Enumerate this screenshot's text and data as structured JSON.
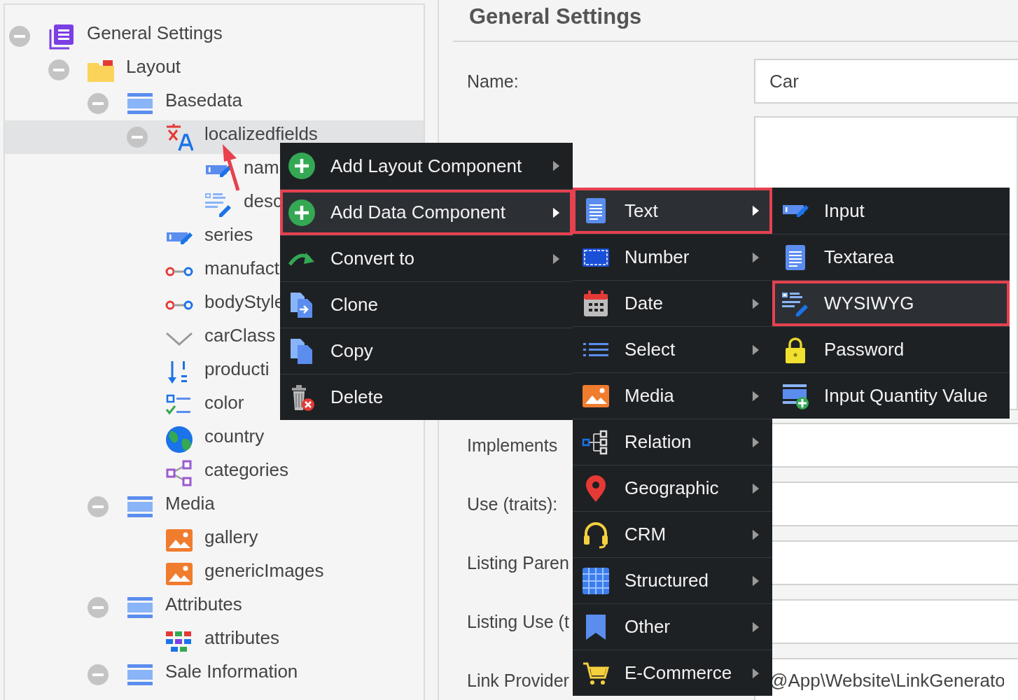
{
  "tree": [
    {
      "label": "General Settings",
      "kind": "root",
      "expanded": true,
      "selected": false,
      "children": [
        {
          "label": "Layout",
          "kind": "layout",
          "expanded": true,
          "selected": false,
          "children": [
            {
              "label": "Basedata",
              "kind": "panel",
              "expanded": true,
              "selected": false,
              "children": [
                {
                  "label": "localizedfields",
                  "kind": "localizedfields",
                  "expanded": true,
                  "selected": true,
                  "children": [
                    {
                      "label": "nam",
                      "kind": "input",
                      "selected": false
                    },
                    {
                      "label": "desc",
                      "kind": "wysiwyg",
                      "selected": false
                    }
                  ]
                },
                {
                  "label": "series",
                  "kind": "input",
                  "selected": false
                },
                {
                  "label": "manufact",
                  "kind": "manyToOneRelation",
                  "selected": false
                },
                {
                  "label": "bodyStyle",
                  "kind": "manyToOneRelation",
                  "selected": false
                },
                {
                  "label": "carClass",
                  "kind": "select",
                  "selected": false
                },
                {
                  "label": "producti",
                  "kind": "numeric",
                  "selected": false
                },
                {
                  "label": "color",
                  "kind": "multiselect",
                  "selected": false
                },
                {
                  "label": "country",
                  "kind": "country",
                  "selected": false
                },
                {
                  "label": "categories",
                  "kind": "manyToManyRelation",
                  "selected": false
                }
              ]
            },
            {
              "label": "Media",
              "kind": "panel",
              "expanded": true,
              "selected": false,
              "children": [
                {
                  "label": "gallery",
                  "kind": "image",
                  "selected": false
                },
                {
                  "label": "genericImages",
                  "kind": "image",
                  "selected": false
                }
              ]
            },
            {
              "label": "Attributes",
              "kind": "panel",
              "expanded": true,
              "selected": false,
              "children": [
                {
                  "label": "attributes",
                  "kind": "classificationstore",
                  "selected": false
                }
              ]
            },
            {
              "label": "Sale Information",
              "kind": "panel",
              "expanded": true,
              "selected": false
            }
          ]
        }
      ]
    }
  ],
  "form": {
    "title": "General Settings",
    "fields": [
      {
        "label": "Name:",
        "kind": "input",
        "value": "Car"
      },
      {
        "kind": "textarea"
      },
      {
        "label": "Implements",
        "kind": "input"
      },
      {
        "label": "Use (traits):",
        "kind": "input"
      },
      {
        "label": "Listing Paren",
        "kind": "input"
      },
      {
        "label": "Listing Use (t",
        "kind": "input"
      },
      {
        "label": "Link Provider",
        "kind": "input",
        "value": "@App\\Website\\LinkGenerato"
      }
    ]
  },
  "context_menu": {
    "items": [
      {
        "label": "Add Layout Component",
        "kind": "add",
        "has_submenu": true,
        "selected": false
      },
      {
        "label": "Add Data Component",
        "kind": "add",
        "has_submenu": true,
        "selected": true
      },
      {
        "label": "Convert to",
        "kind": "convert",
        "has_submenu": true,
        "selected": false
      },
      {
        "label": "Clone",
        "kind": "clone",
        "has_submenu": false,
        "selected": false
      },
      {
        "label": "Copy",
        "kind": "copy",
        "has_submenu": false,
        "selected": false
      },
      {
        "label": "Delete",
        "kind": "delete",
        "has_submenu": false,
        "selected": false
      }
    ]
  },
  "data_component_menu": {
    "items": [
      {
        "label": "Text",
        "kind": "text",
        "has_submenu": true,
        "selected": true
      },
      {
        "label": "Number",
        "kind": "number",
        "has_submenu": true,
        "selected": false
      },
      {
        "label": "Date",
        "kind": "date",
        "has_submenu": true,
        "selected": false
      },
      {
        "label": "Select",
        "kind": "select",
        "has_submenu": true,
        "selected": false
      },
      {
        "label": "Media",
        "kind": "media",
        "has_submenu": true,
        "selected": false
      },
      {
        "label": "Relation",
        "kind": "relation",
        "has_submenu": true,
        "selected": false
      },
      {
        "label": "Geographic",
        "kind": "geographic",
        "has_submenu": true,
        "selected": false
      },
      {
        "label": "CRM",
        "kind": "crm",
        "has_submenu": true,
        "selected": false
      },
      {
        "label": "Structured",
        "kind": "structured",
        "has_submenu": true,
        "selected": false
      },
      {
        "label": "Other",
        "kind": "other",
        "has_submenu": true,
        "selected": false
      },
      {
        "label": "E-Commerce",
        "kind": "ecommerce",
        "has_submenu": true,
        "selected": false
      }
    ]
  },
  "text_menu": {
    "items": [
      {
        "label": "Input",
        "kind": "input",
        "has_submenu": false,
        "selected": false
      },
      {
        "label": "Textarea",
        "kind": "textarea",
        "has_submenu": false,
        "selected": false
      },
      {
        "label": "WYSIWYG",
        "kind": "wysiwyg",
        "has_submenu": false,
        "selected": true
      },
      {
        "label": "Password",
        "kind": "password",
        "has_submenu": false,
        "selected": false
      },
      {
        "label": "Input Quantity Value",
        "kind": "quantity",
        "has_submenu": false,
        "selected": false
      }
    ]
  }
}
